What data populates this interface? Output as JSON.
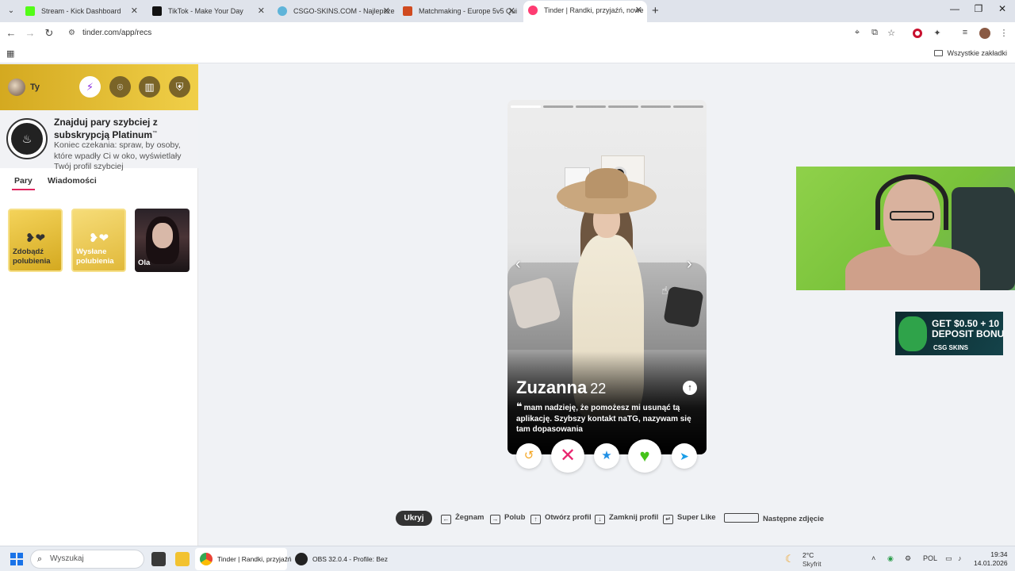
{
  "browser": {
    "tabs": [
      {
        "title": "Stream - Kick Dashboard",
        "color": "#53fc18"
      },
      {
        "title": "TikTok - Make Your Day",
        "color": "#111111"
      },
      {
        "title": "CSGO-SKINS.COM - Najlepsze",
        "color": "#5fb4d9"
      },
      {
        "title": "Matchmaking - Europe 5v5 Qui",
        "color": "#d04a1f"
      },
      {
        "title": "Tinder | Randki, przyjaźń, nowe",
        "color": "#fe3c72"
      }
    ],
    "url": "tinder.com/app/recs",
    "bookmarks_all": "Wszystkie zakładki"
  },
  "sidebar": {
    "user_name": "Ty",
    "promo_title": "Znajduj pary szybciej z subskrypcją Platinum",
    "promo_tm": "™",
    "promo_desc": "Koniec czekania: spraw, by osoby, które wpadły Ci w oko, wyświetlały Twój profil szybciej",
    "tabs": [
      "Pary",
      "Wiadomości"
    ],
    "tiles": [
      {
        "label": "Zdobądź polubienia"
      },
      {
        "label": "Wysłane polubienia"
      },
      {
        "label": "Ola"
      }
    ]
  },
  "card": {
    "name": "Zuzanna",
    "age": "22",
    "bio": "mam nadzieję, że pomożesz mi usunąć tą aplikację. Szybszy kontakt naTG, nazywam się tam dopasowania",
    "photo_count": 6,
    "active_photo": 1
  },
  "hints": {
    "hide": "Ukryj",
    "nope": "Żegnam",
    "like": "Polub",
    "open_profile": "Otwórz profil",
    "close_profile": "Zamknij profil",
    "super_like": "Super Like",
    "next_photo": "Następne zdjęcie"
  },
  "ad": {
    "line1": "GET $0.50 + 10",
    "line2": "DEPOSIT BONU",
    "brand": "CSG SKINS"
  },
  "taskbar": {
    "search_placeholder": "Wyszukaj",
    "chrome_app": "Tinder | Randki, przyjaźń",
    "obs_app": "OBS 32.0.4 - Profile: Bez",
    "weather_temp": "2°C",
    "weather_cond": "Skyfrit",
    "lang": "POL",
    "time": "19:34",
    "date": "14.01.2026"
  }
}
